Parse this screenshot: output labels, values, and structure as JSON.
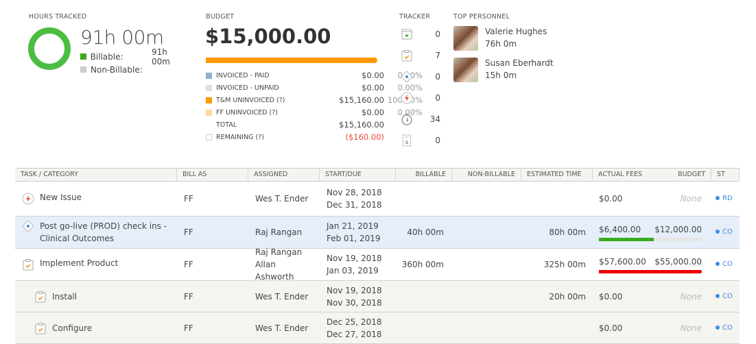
{
  "hours": {
    "label": "HOURS TRACKED",
    "total": "91h 00m",
    "billable_label": "Billable:",
    "billable_value": "91h 00m",
    "nonbillable_label": "Non-Billable:",
    "nonbillable_value": "",
    "billable_color": "#3aaa1e",
    "nonbillable_color": "#cccccc"
  },
  "budget": {
    "label": "BUDGET",
    "amount": "$15,000.00",
    "bar_fill_percent": 100,
    "bar_color": "#ff9900",
    "rows": [
      {
        "name": "INVOICED - PAID",
        "value": "$0.00",
        "pct": "0.00%",
        "color": "#8fb0d3"
      },
      {
        "name": "INVOICED - UNPAID",
        "value": "$0.00",
        "pct": "0.00%",
        "color": "#d6e0ee"
      },
      {
        "name": "T&M UNINVOICED (?)",
        "value": "$15,160.00",
        "pct": "100.00%",
        "color": "#ff9900"
      },
      {
        "name": "FF UNINVOICED (?)",
        "value": "$0.00",
        "pct": "0.00%",
        "color": "#fdd8a0"
      },
      {
        "name": "TOTAL",
        "value": "$15,160.00",
        "pct": ""
      },
      {
        "name": "REMAINING (?)",
        "value": "($160.00)",
        "pct": "",
        "color": "#ffffff"
      }
    ]
  },
  "tracker": {
    "label": "TRACKER",
    "items": [
      {
        "icon": "calendar-star-icon",
        "count": "0"
      },
      {
        "icon": "clipboard-check-icon",
        "count": "7"
      },
      {
        "icon": "milestone-diamond-icon",
        "count": "0"
      },
      {
        "icon": "issue-bolt-icon",
        "count": "0"
      },
      {
        "icon": "stopwatch-icon",
        "count": "34"
      },
      {
        "icon": "receipt-icon",
        "count": "0"
      }
    ]
  },
  "personnel": {
    "label": "TOP PERSONNEL",
    "people": [
      {
        "name": "Valerie Hughes",
        "hours": "76h 0m"
      },
      {
        "name": "Susan Eberhardt",
        "hours": "15h 0m"
      }
    ]
  },
  "table": {
    "headers": [
      "TASK / CATEGORY",
      "BILL AS",
      "ASSIGNED",
      "START/DUE",
      "BILLABLE",
      "NON-BILLABLE",
      "ESTIMATED TIME",
      "ACTUAL FEES",
      "BUDGET",
      "ST"
    ],
    "rows": [
      {
        "icon": "issue-bolt-icon",
        "task": "New Issue",
        "bill_as": "FF",
        "assigned": [
          "Wes T. Ender"
        ],
        "start": "Nov 28, 2018",
        "due": "Dec 31, 2018",
        "billable": "",
        "nonbillable": "",
        "estimated": "",
        "fees": "$0.00",
        "budget": "None",
        "status": "RD"
      },
      {
        "icon": "milestone-diamond-icon",
        "task": "Post go-live (PROD) check ins - Clinical Outcomes",
        "bill_as": "FF",
        "assigned": [
          "Raj Rangan"
        ],
        "start": "Jan 21, 2019",
        "due": "Feb 01, 2019",
        "billable": "40h 00m",
        "nonbillable": "",
        "estimated": "80h 00m",
        "fees": "$6,400.00",
        "budget": "$12,000.00",
        "progress_percent": 53,
        "progress_color": "#3aaa1e",
        "status": "CO"
      },
      {
        "icon": "clipboard-check-icon",
        "task": "Implement Product",
        "bill_as": "FF",
        "assigned": [
          "Raj Rangan",
          "Allan Ashworth"
        ],
        "start": "Nov 19, 2018",
        "due": "Jan 03, 2019",
        "billable": "360h 00m",
        "nonbillable": "",
        "estimated": "325h 00m",
        "fees": "$57,600.00",
        "budget": "$55,000.00",
        "progress_percent": 100,
        "progress_color": "#ee0000",
        "status": "CO"
      },
      {
        "icon": "clipboard-check-icon",
        "task": "Install",
        "bill_as": "FF",
        "assigned": [
          "Wes T. Ender"
        ],
        "start": "Nov 19, 2018",
        "due": "Nov 30, 2018",
        "billable": "",
        "nonbillable": "",
        "estimated": "20h 00m",
        "fees": "$0.00",
        "budget": "None",
        "status": "CO"
      },
      {
        "icon": "clipboard-check-icon",
        "task": "Configure",
        "bill_as": "FF",
        "assigned": [
          "Wes T. Ender"
        ],
        "start": "Dec 25, 2018",
        "due": "Dec 27, 2018",
        "billable": "",
        "nonbillable": "",
        "estimated": "",
        "fees": "$0.00",
        "budget": "None",
        "status": "CO"
      }
    ]
  }
}
